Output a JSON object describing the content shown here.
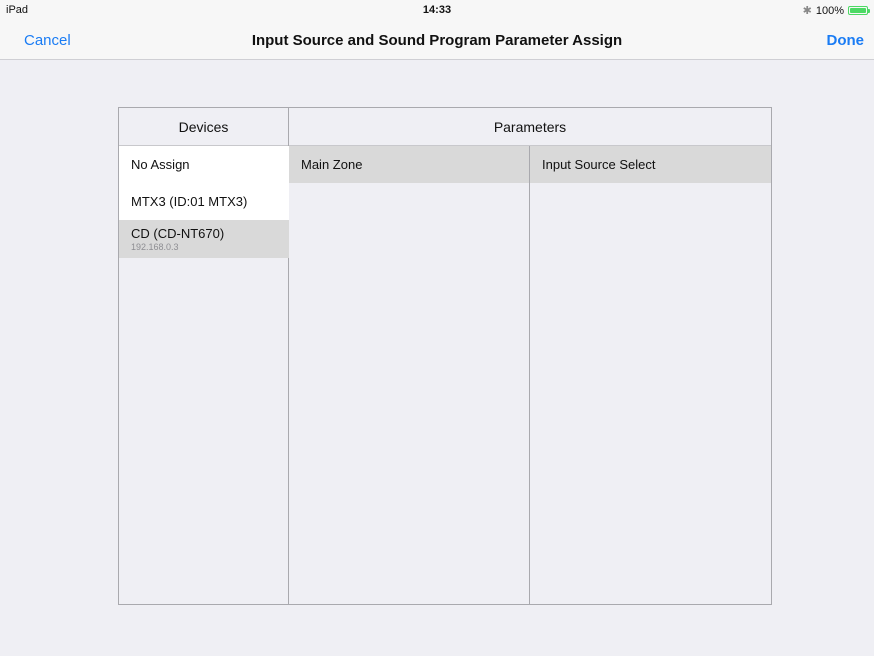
{
  "status_bar": {
    "carrier": "iPad",
    "time": "14:33",
    "bluetooth_icon": "bluetooth-icon",
    "battery_percent": "100%",
    "battery_level": 1.0,
    "battery_color": "#4cd964"
  },
  "nav": {
    "cancel_label": "Cancel",
    "title": "Input Source and Sound Program Parameter Assign",
    "done_label": "Done",
    "accent_color": "#1a7cf4"
  },
  "table": {
    "devices_header": "Devices",
    "parameters_header": "Parameters",
    "devices": [
      {
        "name": "No Assign",
        "sub": ""
      },
      {
        "name": "MTX3 (ID:01 MTX3)",
        "sub": ""
      },
      {
        "name": "CD (CD-NT670)",
        "sub": "192.168.0.3",
        "selected": true
      }
    ],
    "zones": [
      {
        "name": "Main Zone",
        "selected": true
      }
    ],
    "parameters": [
      {
        "name": "Input Source Select",
        "selected": true
      }
    ]
  }
}
